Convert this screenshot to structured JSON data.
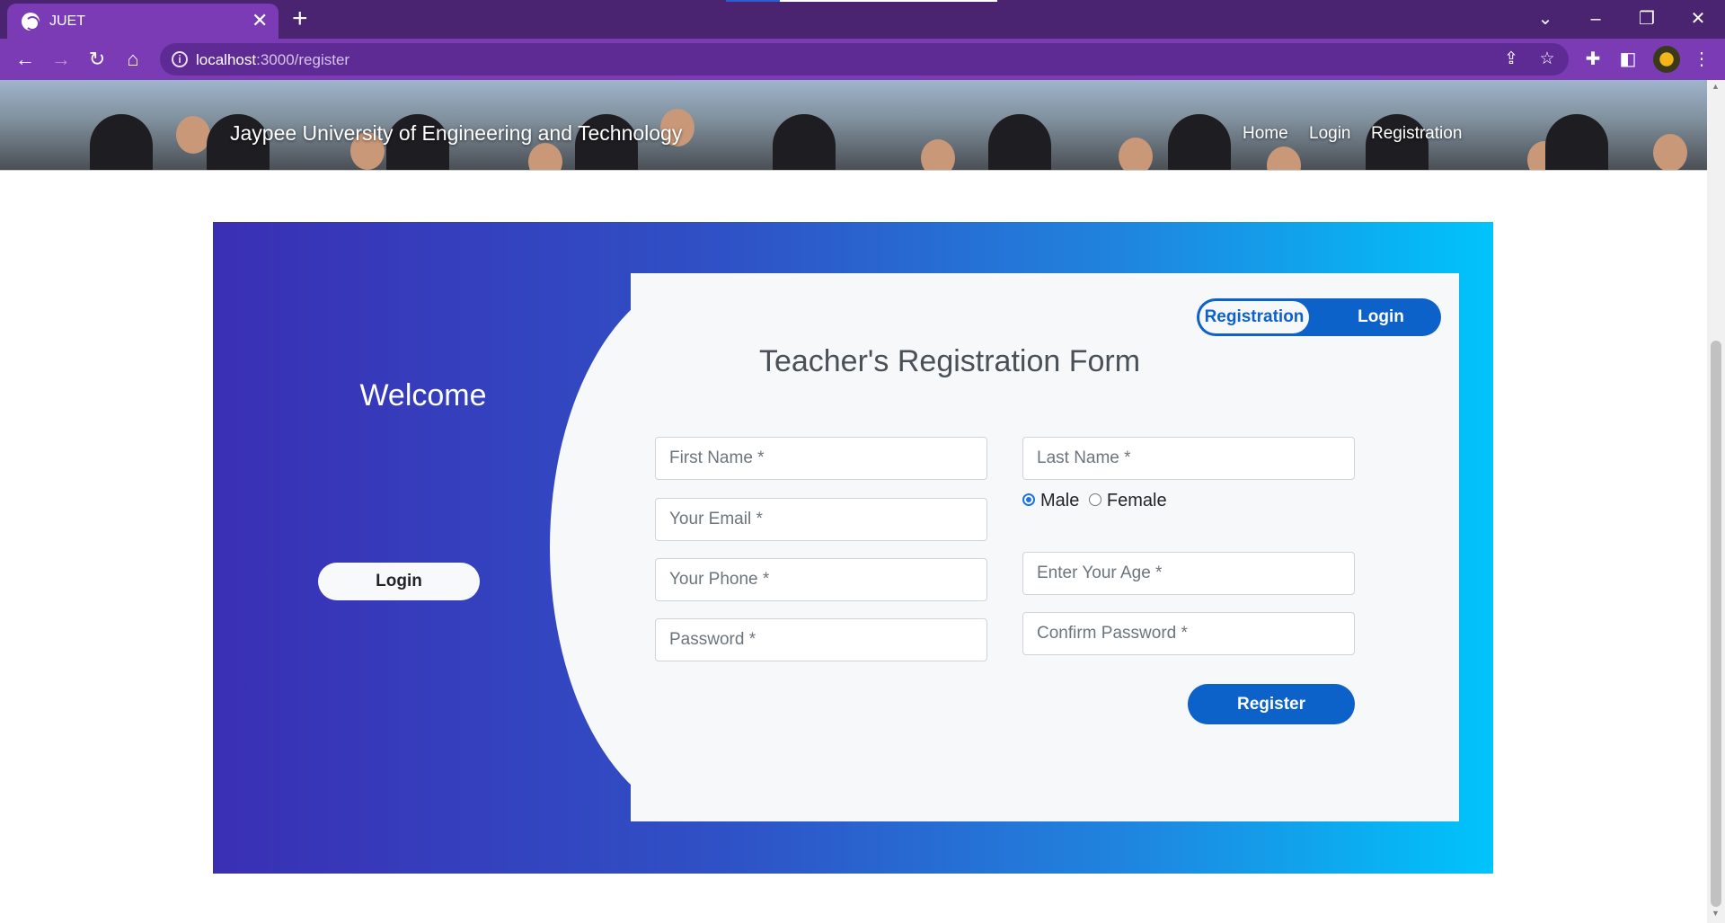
{
  "browser": {
    "tab_title": "JUET",
    "url_host": "localhost",
    "url_path": ":3000/register"
  },
  "header": {
    "brand": "Jaypee University of Engineering and Technology",
    "nav": [
      "Home",
      "Login",
      "Registration"
    ]
  },
  "sidebar": {
    "welcome": "Welcome",
    "login_button": "Login"
  },
  "form": {
    "toggle_registration": "Registration",
    "toggle_login": "Login",
    "title": "Teacher's Registration Form",
    "first_name_placeholder": "First Name *",
    "last_name_placeholder": "Last Name *",
    "email_placeholder": "Your Email *",
    "phone_placeholder": "Your Phone *",
    "password_placeholder": "Password *",
    "age_placeholder": "Enter Your Age *",
    "confirm_password_placeholder": "Confirm Password *",
    "gender_options": [
      "Male",
      "Female"
    ],
    "gender_selected": "Male",
    "submit_label": "Register"
  },
  "colors": {
    "chrome_purple": "#7a3bb5",
    "card_gradient_start": "#3a2fb4",
    "card_gradient_end": "#00c4fb",
    "accent_blue": "#0d62c9"
  }
}
